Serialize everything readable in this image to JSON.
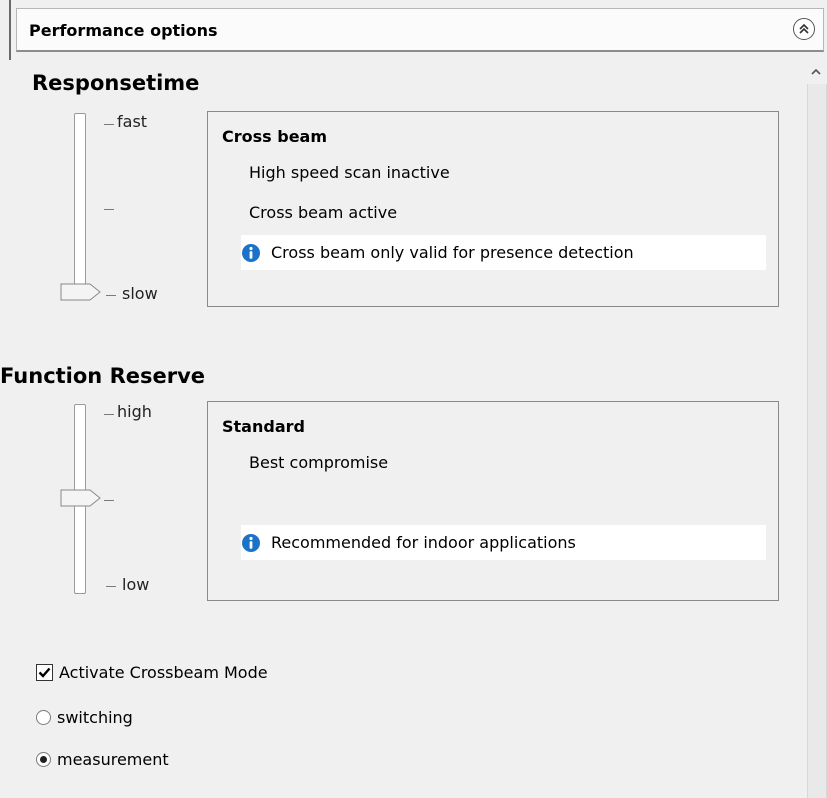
{
  "panel": {
    "title": "Performance options"
  },
  "responsetime": {
    "title": "Responsetime",
    "slider": {
      "top_label": "fast",
      "bottom_label": "slow",
      "value": "slow"
    },
    "box": {
      "title": "Cross beam",
      "line1": "High speed scan inactive",
      "line2": "Cross beam active",
      "note": "Cross beam only valid for presence detection"
    }
  },
  "function_reserve": {
    "title": "Function Reserve",
    "slider": {
      "top_label": "high",
      "bottom_label": "low",
      "value": "middle"
    },
    "box": {
      "title": "Standard",
      "line1": "Best compromise",
      "note": "Recommended for indoor applications"
    }
  },
  "options": {
    "crossbeam_checkbox": {
      "label": "Activate Crossbeam Mode",
      "checked": true
    },
    "radio_switching": {
      "label": "switching",
      "selected": false
    },
    "radio_measurement": {
      "label": "measurement",
      "selected": true
    }
  },
  "colors": {
    "info_icon": "#1a73c8",
    "background": "#f0f0f0"
  },
  "icons": {
    "collapse": "double-chevron-up-icon",
    "info": "info-icon",
    "scroll_up": "chevron-up-icon"
  }
}
